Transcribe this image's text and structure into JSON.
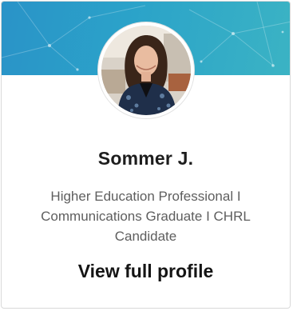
{
  "profile": {
    "name": "Sommer J.",
    "headline_lines": [
      "Higher Education Professional I",
      "Communications Graduate I CHRL",
      "Candidate"
    ],
    "view_profile_label": "View full profile"
  },
  "colors": {
    "banner_start": "#2a93c8",
    "banner_end": "#3bb3c4",
    "name_text": "#1d1d1d",
    "headline_text": "#5e5e5e"
  },
  "icons": {
    "avatar": "profile-photo"
  }
}
